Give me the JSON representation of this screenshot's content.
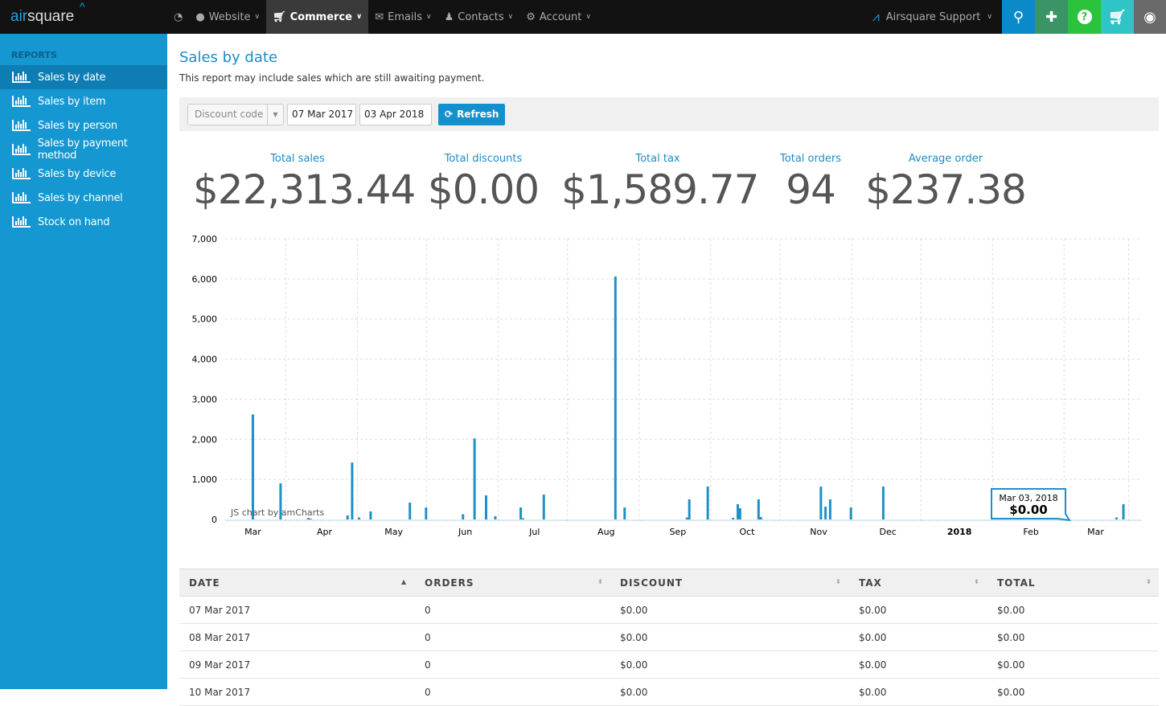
{
  "nav": {
    "logo": "airsquare",
    "items": [
      {
        "label": "",
        "icon": "dashboard-icon"
      },
      {
        "label": "Website",
        "icon": "globe-icon"
      },
      {
        "label": "Commerce",
        "icon": "cart-icon",
        "active": true
      },
      {
        "label": "Emails",
        "icon": "envelope-icon"
      },
      {
        "label": "Contacts",
        "icon": "user-icon"
      },
      {
        "label": "Account",
        "icon": "gear-icon"
      }
    ],
    "support": "Airsquare Support",
    "buttons": [
      {
        "icon": "search-icon",
        "color": "#0a8ac9"
      },
      {
        "icon": "plus-icon",
        "color": "#3a9466"
      },
      {
        "icon": "help-icon",
        "color": "#2bc33c"
      },
      {
        "icon": "cart-icon",
        "color": "#2fc4c6"
      },
      {
        "icon": "eye-icon",
        "color": "#6a6a6a"
      }
    ]
  },
  "sidebar": {
    "heading": "REPORTS",
    "items": [
      {
        "label": "Sales by date",
        "active": true
      },
      {
        "label": "Sales by item"
      },
      {
        "label": "Sales by person"
      },
      {
        "label": "Sales by payment method"
      },
      {
        "label": "Sales by device"
      },
      {
        "label": "Sales by channel"
      },
      {
        "label": "Stock on hand"
      }
    ]
  },
  "page": {
    "title": "Sales by date",
    "subtitle": "This report may include sales which are still awaiting payment."
  },
  "filter": {
    "discount_placeholder": "Discount code",
    "from": "07 Mar 2017",
    "to": "03 Apr 2018",
    "refresh": "Refresh"
  },
  "stats": [
    {
      "label": "Total sales",
      "value": "$22,313.44"
    },
    {
      "label": "Total discounts",
      "value": "$0.00"
    },
    {
      "label": "Total tax",
      "value": "$1,589.77"
    },
    {
      "label": "Total orders",
      "value": "94"
    },
    {
      "label": "Average order",
      "value": "$237.38"
    }
  ],
  "chart_data": {
    "type": "bar",
    "credit": "JS chart by amCharts",
    "ylim": [
      0,
      7000
    ],
    "yticks": [
      "0",
      "1,000",
      "2,000",
      "3,000",
      "4,000",
      "5,000",
      "6,000",
      "7,000"
    ],
    "xticks": [
      {
        "date": "2017-03-01",
        "label": "Mar"
      },
      {
        "date": "2017-04-01",
        "label": "Apr"
      },
      {
        "date": "2017-05-01",
        "label": "May"
      },
      {
        "date": "2017-06-01",
        "label": "Jun"
      },
      {
        "date": "2017-07-01",
        "label": "Jul"
      },
      {
        "date": "2017-08-01",
        "label": "Aug"
      },
      {
        "date": "2017-09-01",
        "label": "Sep"
      },
      {
        "date": "2017-10-01",
        "label": "Oct"
      },
      {
        "date": "2017-11-01",
        "label": "Nov"
      },
      {
        "date": "2017-12-01",
        "label": "Dec"
      },
      {
        "date": "2018-01-01",
        "label": "2018",
        "bold": true
      },
      {
        "date": "2018-02-01",
        "label": "Feb"
      },
      {
        "date": "2018-03-01",
        "label": "Mar"
      }
    ],
    "color": "#1e90c8",
    "points": [
      [
        "2017-03-01",
        2620
      ],
      [
        "2017-03-13",
        900
      ],
      [
        "2017-03-25",
        40
      ],
      [
        "2017-03-26",
        20
      ],
      [
        "2017-04-11",
        100
      ],
      [
        "2017-04-13",
        1420
      ],
      [
        "2017-04-16",
        50
      ],
      [
        "2017-04-21",
        200
      ],
      [
        "2017-05-08",
        420
      ],
      [
        "2017-05-15",
        300
      ],
      [
        "2017-05-31",
        130
      ],
      [
        "2017-06-05",
        2020
      ],
      [
        "2017-06-10",
        600
      ],
      [
        "2017-06-14",
        80
      ],
      [
        "2017-06-25",
        300
      ],
      [
        "2017-06-26",
        30
      ],
      [
        "2017-07-05",
        620
      ],
      [
        "2017-08-05",
        6060
      ],
      [
        "2017-08-09",
        300
      ],
      [
        "2017-09-05",
        50
      ],
      [
        "2017-09-06",
        500
      ],
      [
        "2017-09-14",
        820
      ],
      [
        "2017-09-25",
        40
      ],
      [
        "2017-09-27",
        380
      ],
      [
        "2017-09-28",
        280
      ],
      [
        "2017-10-06",
        500
      ],
      [
        "2017-10-07",
        60
      ],
      [
        "2017-11-02",
        820
      ],
      [
        "2017-11-04",
        320
      ],
      [
        "2017-11-06",
        500
      ],
      [
        "2017-11-15",
        300
      ],
      [
        "2017-11-29",
        820
      ],
      [
        "2018-03-10",
        50
      ],
      [
        "2018-03-13",
        380
      ]
    ],
    "tooltip": {
      "date": "Mar 03, 2018",
      "value": "$0.00"
    }
  },
  "table": {
    "columns": [
      "DATE",
      "ORDERS",
      "DISCOUNT",
      "TAX",
      "TOTAL"
    ],
    "rows": [
      [
        "07 Mar 2017",
        "0",
        "$0.00",
        "$0.00",
        "$0.00"
      ],
      [
        "08 Mar 2017",
        "0",
        "$0.00",
        "$0.00",
        "$0.00"
      ],
      [
        "09 Mar 2017",
        "0",
        "$0.00",
        "$0.00",
        "$0.00"
      ],
      [
        "10 Mar 2017",
        "0",
        "$0.00",
        "$0.00",
        "$0.00"
      ]
    ]
  }
}
